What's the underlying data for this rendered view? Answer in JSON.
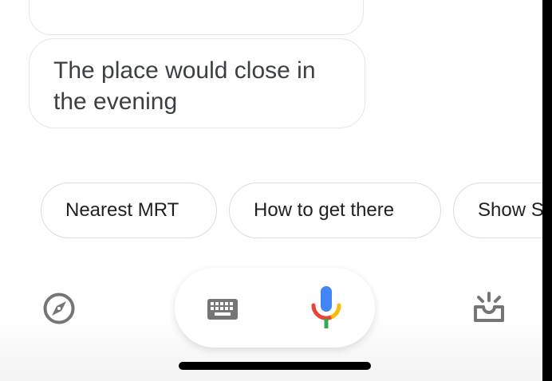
{
  "conversation": {
    "assistant_reply": "The place would close in the evening"
  },
  "suggestions": [
    {
      "label": "Nearest MRT"
    },
    {
      "label": "How to get there"
    },
    {
      "label": "Show S"
    }
  ],
  "bottom_bar": {
    "left_icon": "compass-icon",
    "keyboard_icon": "keyboard-icon",
    "mic_icon": "microphone-icon",
    "right_icon": "updates-tray-icon"
  },
  "colors": {
    "mic_blue": "#4285F4",
    "mic_red": "#EA4335",
    "mic_yellow": "#FBBC05",
    "mic_green": "#34A853",
    "icon_gray": "#757575",
    "text": "#3c4043"
  }
}
